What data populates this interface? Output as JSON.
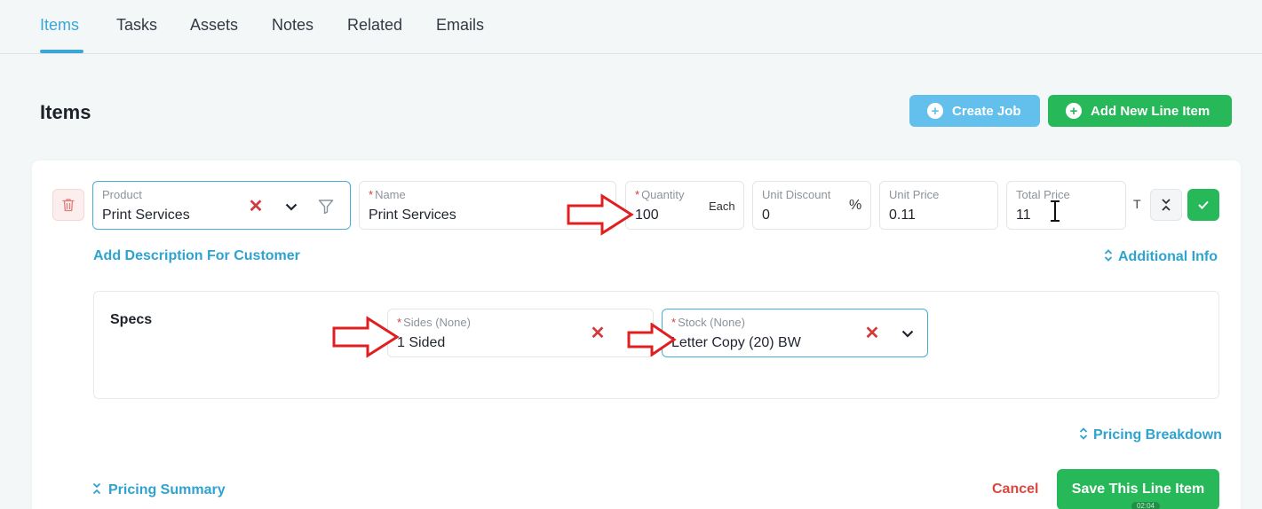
{
  "tabs": [
    {
      "label": "Items",
      "active": true
    },
    {
      "label": "Tasks",
      "active": false
    },
    {
      "label": "Assets",
      "active": false
    },
    {
      "label": "Notes",
      "active": false
    },
    {
      "label": "Related",
      "active": false
    },
    {
      "label": "Emails",
      "active": false
    }
  ],
  "header": {
    "title": "Items",
    "create_job": "Create Job",
    "add_line_item": "Add New Line Item"
  },
  "line_item": {
    "product": {
      "label": "Product",
      "value": "Print Services"
    },
    "name": {
      "label": "Name",
      "value": "Print Services",
      "required": true
    },
    "quantity": {
      "label": "Quantity",
      "value": "100",
      "unit": "Each",
      "required": true
    },
    "unit_discount": {
      "label": "Unit Discount",
      "value": "0",
      "suffix": "%"
    },
    "unit_price": {
      "label": "Unit Price",
      "value": "0.11"
    },
    "total_price": {
      "label": "Total Price",
      "value": "11"
    },
    "t_label": "T",
    "add_description": "Add Description For Customer",
    "additional_info": "Additional Info"
  },
  "specs": {
    "title": "Specs",
    "sides": {
      "label": "Sides (None)",
      "value": "1 Sided",
      "required": true
    },
    "stock": {
      "label": "Stock (None)",
      "value": "Letter Copy (20) BW",
      "required": true
    }
  },
  "footer": {
    "pricing_breakdown": "Pricing Breakdown",
    "pricing_summary": "Pricing Summary",
    "cancel": "Cancel",
    "save": "Save This Line Item",
    "badge": "02:04"
  },
  "colors": {
    "accent": "#3aa7d6",
    "green": "#27b85a",
    "light_blue": "#63c0ec",
    "danger": "#d33a3a",
    "annotation_arrow": "#e02020"
  },
  "icons": [
    "trash-icon",
    "clear-icon",
    "chevron-down-icon",
    "filter-icon",
    "collapse-icon",
    "check-icon",
    "expand-icon",
    "text-cursor-icon",
    "annotation-arrow"
  ]
}
